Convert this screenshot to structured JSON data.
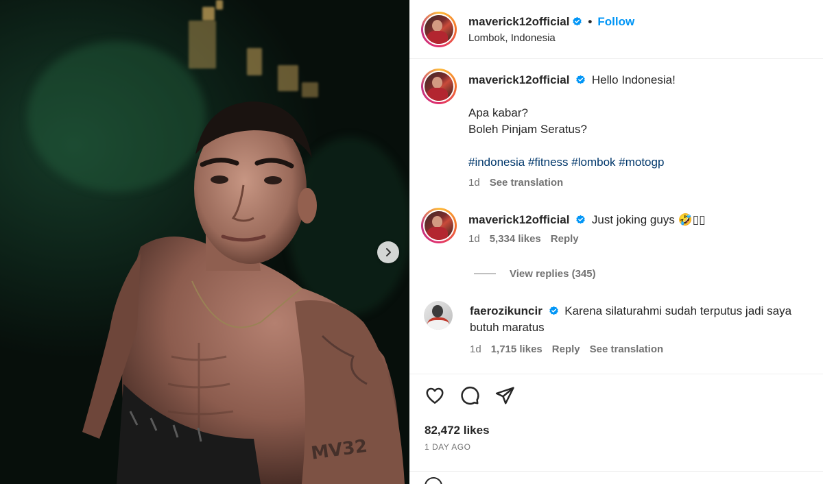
{
  "post": {
    "username": "maverick12official",
    "follow_label": "Follow",
    "location": "Lombok, Indonesia",
    "verified": true
  },
  "caption": {
    "username": "maverick12official",
    "text_line1": "Hello Indonesia!",
    "text_line2": "Apa kabar?",
    "text_line3": "Boleh Pinjam Seratus?",
    "hashtags": "#indonesia #fitness #lombok #motogp",
    "time": "1d",
    "see_translation": "See translation"
  },
  "comments": [
    {
      "username": "maverick12official",
      "text": "Just joking guys",
      "emoji": "🤣",
      "emoji_tail": "▯▯",
      "time": "1d",
      "likes": "5,334 likes",
      "reply": "Reply",
      "view_replies": "View replies (345)"
    },
    {
      "username": "faerozikuncir",
      "text_line1": "Karena silaturahmi sudah terputus jadi saya",
      "text_line2": "butuh maratus",
      "time": "1d",
      "likes": "1,715 likes",
      "reply": "Reply",
      "see_translation": "See translation"
    }
  ],
  "footer": {
    "likes": "82,472 likes",
    "time_ago": "1 DAY AGO"
  },
  "icons": {
    "like": "heart-icon",
    "comment": "comment-icon",
    "share": "share-icon",
    "next": "chevron-right-icon",
    "verified": "verified-badge-icon"
  },
  "colors": {
    "accent": "#0095f6",
    "hashtag": "#00376b",
    "muted": "#737373",
    "verified": "#0095f6"
  }
}
